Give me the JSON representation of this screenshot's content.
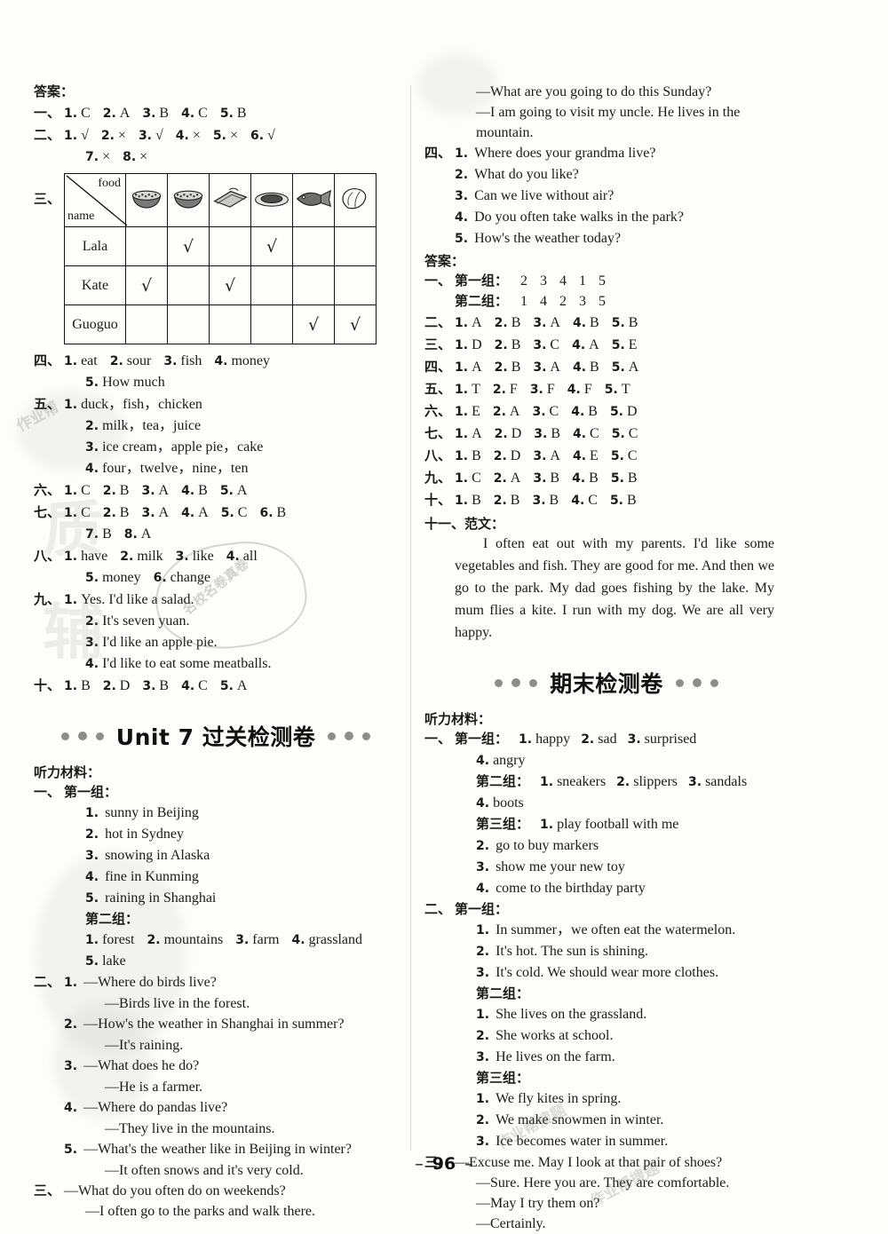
{
  "page": {
    "number": "96",
    "dash_left": "–",
    "dash_right": "–"
  },
  "left_column": {
    "answers_label": "答案：",
    "key_rows": [
      {
        "cn": "一、",
        "items": [
          {
            "n": "1.",
            "v": "C"
          },
          {
            "n": "2.",
            "v": "A"
          },
          {
            "n": "3.",
            "v": "B"
          },
          {
            "n": "4.",
            "v": "C"
          },
          {
            "n": "5.",
            "v": "B"
          }
        ]
      },
      {
        "cn": "二、",
        "items": [
          {
            "n": "1.",
            "v": "√"
          },
          {
            "n": "2.",
            "v": "×"
          },
          {
            "n": "3.",
            "v": "√"
          },
          {
            "n": "4.",
            "v": "×"
          },
          {
            "n": "5.",
            "v": "×"
          },
          {
            "n": "6.",
            "v": "√"
          }
        ]
      },
      {
        "cn": "",
        "items": [
          {
            "n": "7.",
            "v": "×"
          },
          {
            "n": "8.",
            "v": "×"
          }
        ]
      }
    ],
    "table_marker": "三、",
    "table": {
      "corner_top": "food",
      "corner_bottom": "name",
      "food_icons": [
        "soup-bowl-icon",
        "noodles-bowl-icon",
        "sandwich-icon",
        "plate-dish-icon",
        "fish-icon",
        "vegetable-icon"
      ],
      "rows": [
        {
          "name": "Lala",
          "checks": [
            false,
            true,
            false,
            true,
            false,
            false
          ]
        },
        {
          "name": "Kate",
          "checks": [
            true,
            false,
            true,
            false,
            false,
            false
          ]
        },
        {
          "name": "Guoguo",
          "checks": [
            false,
            false,
            false,
            false,
            true,
            true
          ]
        }
      ],
      "check_glyph": "√"
    },
    "sections": [
      {
        "cn": "四、",
        "lines": [
          {
            "indent": 0,
            "items": [
              {
                "n": "1.",
                "v": "eat"
              },
              {
                "n": "2.",
                "v": "sour"
              },
              {
                "n": "3.",
                "v": "fish"
              },
              {
                "n": "4.",
                "v": "money"
              }
            ]
          },
          {
            "indent": 1,
            "items": [
              {
                "n": "5.",
                "v": "How much"
              }
            ]
          }
        ]
      },
      {
        "cn": "五、",
        "lines": [
          {
            "indent": 0,
            "items": [
              {
                "n": "1.",
                "v": "duck，fish，chicken"
              }
            ]
          },
          {
            "indent": 1,
            "items": [
              {
                "n": "2.",
                "v": "milk，tea，juice"
              }
            ]
          },
          {
            "indent": 1,
            "items": [
              {
                "n": "3.",
                "v": "ice cream，apple pie，cake"
              }
            ]
          },
          {
            "indent": 1,
            "items": [
              {
                "n": "4.",
                "v": "four，twelve，nine，ten"
              }
            ]
          }
        ]
      },
      {
        "cn": "六、",
        "lines": [
          {
            "indent": 0,
            "items": [
              {
                "n": "1.",
                "v": "C"
              },
              {
                "n": "2.",
                "v": "B"
              },
              {
                "n": "3.",
                "v": "A"
              },
              {
                "n": "4.",
                "v": "B"
              },
              {
                "n": "5.",
                "v": "A"
              }
            ]
          }
        ]
      },
      {
        "cn": "七、",
        "lines": [
          {
            "indent": 0,
            "items": [
              {
                "n": "1.",
                "v": "C"
              },
              {
                "n": "2.",
                "v": "B"
              },
              {
                "n": "3.",
                "v": "A"
              },
              {
                "n": "4.",
                "v": "A"
              },
              {
                "n": "5.",
                "v": "C"
              },
              {
                "n": "6.",
                "v": "B"
              }
            ]
          },
          {
            "indent": 1,
            "items": [
              {
                "n": "7.",
                "v": "B"
              },
              {
                "n": "8.",
                "v": "A"
              }
            ]
          }
        ]
      },
      {
        "cn": "八、",
        "lines": [
          {
            "indent": 0,
            "items": [
              {
                "n": "1.",
                "v": "have"
              },
              {
                "n": "2.",
                "v": "milk"
              },
              {
                "n": "3.",
                "v": "like"
              },
              {
                "n": "4.",
                "v": "all"
              }
            ]
          },
          {
            "indent": 1,
            "items": [
              {
                "n": "5.",
                "v": "money"
              },
              {
                "n": "6.",
                "v": "change"
              }
            ]
          }
        ]
      },
      {
        "cn": "九、",
        "lines": [
          {
            "indent": 0,
            "items": [
              {
                "n": "1.",
                "v": "Yes. I'd like a salad."
              }
            ]
          },
          {
            "indent": 1,
            "items": [
              {
                "n": "2.",
                "v": "It's seven yuan."
              }
            ]
          },
          {
            "indent": 1,
            "items": [
              {
                "n": "3.",
                "v": "I'd like an apple pie."
              }
            ]
          },
          {
            "indent": 1,
            "items": [
              {
                "n": "4.",
                "v": "I'd like to eat some meatballs."
              }
            ]
          }
        ]
      },
      {
        "cn": "十、",
        "lines": [
          {
            "indent": 0,
            "items": [
              {
                "n": "1.",
                "v": "B"
              },
              {
                "n": "2.",
                "v": "D"
              },
              {
                "n": "3.",
                "v": "B"
              },
              {
                "n": "4.",
                "v": "C"
              },
              {
                "n": "5.",
                "v": "A"
              }
            ]
          }
        ]
      }
    ],
    "unit7_heading": "Unit 7 过关检测卷",
    "listening_label": "听力材料：",
    "u7_group1_marker": "一、",
    "u7_group1_label": "第一组：",
    "u7_group1": [
      {
        "n": "1.",
        "v": "sunny in Beijing"
      },
      {
        "n": "2.",
        "v": "hot in Sydney"
      },
      {
        "n": "3.",
        "v": "snowing in Alaska"
      },
      {
        "n": "4.",
        "v": "fine in Kunming"
      },
      {
        "n": "5.",
        "v": "raining in Shanghai"
      }
    ],
    "u7_group2_label": "第二组：",
    "u7_group2_line1": [
      {
        "n": "1.",
        "v": "forest"
      },
      {
        "n": "2.",
        "v": "mountains"
      },
      {
        "n": "3.",
        "v": "farm"
      },
      {
        "n": "4.",
        "v": "grassland"
      }
    ],
    "u7_group2_line2": [
      {
        "n": "5.",
        "v": "lake"
      }
    ],
    "u7_section2_marker": "二、",
    "u7_dialogues": [
      {
        "n": "1.",
        "q": "—Where do birds live?",
        "a": "—Birds live in the forest."
      },
      {
        "n": "2.",
        "q": "—How's the weather in Shanghai in summer?",
        "a": "—It's raining."
      },
      {
        "n": "3.",
        "q": "—What does he do?",
        "a": "—He is a farmer."
      },
      {
        "n": "4.",
        "q": "—Where do pandas live?",
        "a": "—They live in the mountains."
      },
      {
        "n": "5.",
        "q": "—What's the weather like in Beijing in winter?",
        "a": "—It often snows and it's very cold."
      }
    ],
    "u7_section3_marker": "三、",
    "u7_section3_q": "—What do you often do on weekends?",
    "u7_section3_a": "—I often go to the parks and walk there."
  },
  "right_column": {
    "top_dialogue": [
      "—What are you going to do this Sunday?",
      "—I am going to visit my uncle.  He lives in the mountain."
    ],
    "section4_marker": "四、",
    "section4": [
      {
        "n": "1.",
        "v": "Where does your grandma live?"
      },
      {
        "n": "2.",
        "v": "What do you like?"
      },
      {
        "n": "3.",
        "v": "Can we live without air?"
      },
      {
        "n": "4.",
        "v": "Do you often take walks in the park?"
      },
      {
        "n": "5.",
        "v": "How's the weather today?"
      }
    ],
    "answers_label": "答案：",
    "group_rows": [
      {
        "cn": "一、",
        "label": "第一组：",
        "values": [
          "2",
          "3",
          "4",
          "1",
          "5"
        ]
      },
      {
        "cn": "",
        "label": "第二组：",
        "values": [
          "1",
          "4",
          "2",
          "3",
          "5"
        ]
      }
    ],
    "key_rows": [
      {
        "cn": "二、",
        "items": [
          {
            "n": "1.",
            "v": "A"
          },
          {
            "n": "2.",
            "v": "B"
          },
          {
            "n": "3.",
            "v": "A"
          },
          {
            "n": "4.",
            "v": "B"
          },
          {
            "n": "5.",
            "v": "B"
          }
        ]
      },
      {
        "cn": "三、",
        "items": [
          {
            "n": "1.",
            "v": "D"
          },
          {
            "n": "2.",
            "v": "B"
          },
          {
            "n": "3.",
            "v": "C"
          },
          {
            "n": "4.",
            "v": "A"
          },
          {
            "n": "5.",
            "v": "E"
          }
        ]
      },
      {
        "cn": "四、",
        "items": [
          {
            "n": "1.",
            "v": "A"
          },
          {
            "n": "2.",
            "v": "B"
          },
          {
            "n": "3.",
            "v": "A"
          },
          {
            "n": "4.",
            "v": "B"
          },
          {
            "n": "5.",
            "v": "A"
          }
        ]
      },
      {
        "cn": "五、",
        "items": [
          {
            "n": "1.",
            "v": "T"
          },
          {
            "n": "2.",
            "v": "F"
          },
          {
            "n": "3.",
            "v": "F"
          },
          {
            "n": "4.",
            "v": "F"
          },
          {
            "n": "5.",
            "v": "T"
          }
        ]
      },
      {
        "cn": "六、",
        "items": [
          {
            "n": "1.",
            "v": "E"
          },
          {
            "n": "2.",
            "v": "A"
          },
          {
            "n": "3.",
            "v": "C"
          },
          {
            "n": "4.",
            "v": "B"
          },
          {
            "n": "5.",
            "v": "D"
          }
        ]
      },
      {
        "cn": "七、",
        "items": [
          {
            "n": "1.",
            "v": "A"
          },
          {
            "n": "2.",
            "v": "D"
          },
          {
            "n": "3.",
            "v": "B"
          },
          {
            "n": "4.",
            "v": "C"
          },
          {
            "n": "5.",
            "v": "C"
          }
        ]
      },
      {
        "cn": "八、",
        "items": [
          {
            "n": "1.",
            "v": "B"
          },
          {
            "n": "2.",
            "v": "D"
          },
          {
            "n": "3.",
            "v": "A"
          },
          {
            "n": "4.",
            "v": "E"
          },
          {
            "n": "5.",
            "v": "C"
          }
        ]
      },
      {
        "cn": "九、",
        "items": [
          {
            "n": "1.",
            "v": "C"
          },
          {
            "n": "2.",
            "v": "A"
          },
          {
            "n": "3.",
            "v": "B"
          },
          {
            "n": "4.",
            "v": "B"
          },
          {
            "n": "5.",
            "v": "B"
          }
        ]
      },
      {
        "cn": "十、",
        "items": [
          {
            "n": "1.",
            "v": "B"
          },
          {
            "n": "2.",
            "v": "B"
          },
          {
            "n": "3.",
            "v": "B"
          },
          {
            "n": "4.",
            "v": "C"
          },
          {
            "n": "5.",
            "v": "B"
          }
        ]
      }
    ],
    "essay_marker": "十一、范文：",
    "essay": "I often eat out with my parents.  I'd like some vegetables and fish.  They are good for me.  And then we go to the park.  My dad goes fishing by the lake.  My mum flies a kite.  I run with my dog.  We are all very happy.",
    "final_heading": "期末检测卷",
    "listening_label": "听力材料：",
    "f_group1_marker": "一、",
    "f_group1_label": "第一组：",
    "f_group1_line1": [
      {
        "n": "1.",
        "v": "happy"
      },
      {
        "n": "2.",
        "v": "sad"
      },
      {
        "n": "3.",
        "v": "surprised"
      }
    ],
    "f_group1_line2": [
      {
        "n": "4.",
        "v": "angry"
      }
    ],
    "f_group2_label": "第二组：",
    "f_group2_line1": [
      {
        "n": "1.",
        "v": "sneakers"
      },
      {
        "n": "2.",
        "v": "slippers"
      },
      {
        "n": "3.",
        "v": "sandals"
      }
    ],
    "f_group2_line2": [
      {
        "n": "4.",
        "v": "boots"
      }
    ],
    "f_group3_label": "第三组：",
    "f_group3": [
      {
        "n": "1.",
        "v": "play football with me"
      },
      {
        "n": "2.",
        "v": "go to buy markers"
      },
      {
        "n": "3.",
        "v": "show me your new toy"
      },
      {
        "n": "4.",
        "v": "come to the birthday party"
      }
    ],
    "f_section2_marker": "二、",
    "f_s2_g1_label": "第一组：",
    "f_s2_g1": [
      {
        "n": "1.",
        "v": "In summer，we often eat the watermelon."
      },
      {
        "n": "2.",
        "v": "It's hot.  The sun is shining."
      },
      {
        "n": "3.",
        "v": "It's cold.  We should wear more clothes."
      }
    ],
    "f_s2_g2_label": "第二组：",
    "f_s2_g2": [
      {
        "n": "1.",
        "v": "She lives on the grassland."
      },
      {
        "n": "2.",
        "v": "She works at school."
      },
      {
        "n": "3.",
        "v": "He lives on the farm."
      }
    ],
    "f_s2_g3_label": "第三组：",
    "f_s2_g3": [
      {
        "n": "1.",
        "v": "We fly kites in spring."
      },
      {
        "n": "2.",
        "v": "We make snowmen in winter."
      },
      {
        "n": "3.",
        "v": "Ice becomes water in summer."
      }
    ],
    "f_section3_marker": "三、",
    "f_section3": [
      "—Excuse me.  May I look at that pair of shoes?",
      "—Sure.  Here you are.  They are comfortable.",
      "—May I try them on?",
      "—Certainly."
    ]
  },
  "watermarks": {
    "corner_small": "作业帮",
    "bottom_right": "作业帮搜题",
    "big_vertical": "质 辅",
    "stamp_text": "名校名卷真卷"
  },
  "colors": {
    "ink": "#1a1a1a",
    "paper": "#fdfdfb",
    "dot": "#8d8d8d",
    "rule": "#d8d8d4"
  }
}
